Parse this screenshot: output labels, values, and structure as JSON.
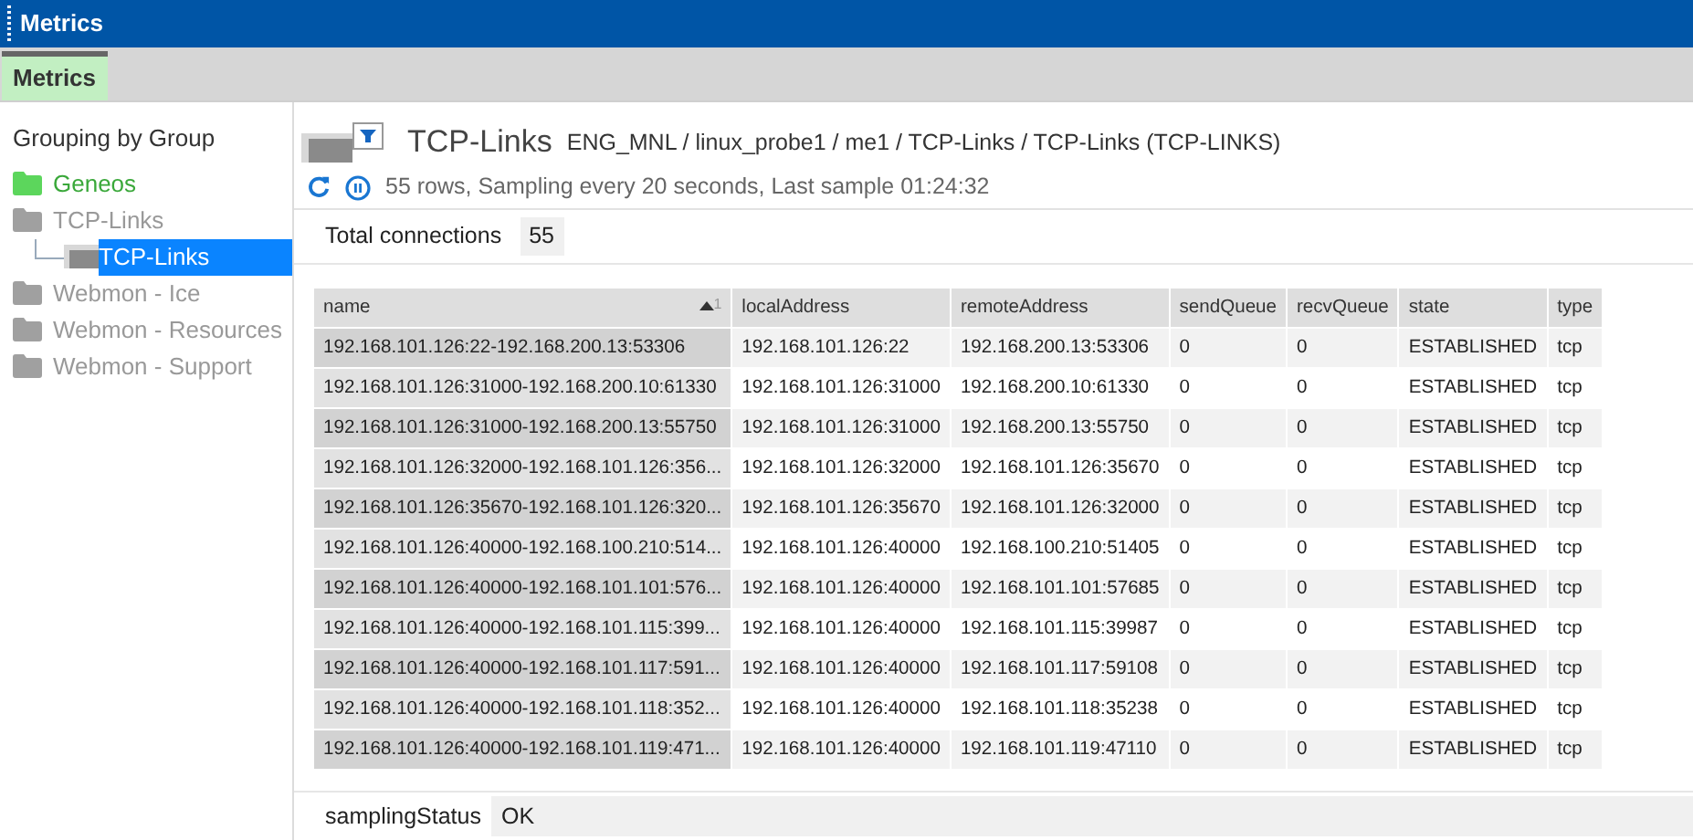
{
  "window": {
    "title": "Metrics"
  },
  "tabs": [
    {
      "label": "Metrics",
      "selected": true
    }
  ],
  "sidebar": {
    "title": "Grouping by Group",
    "items": [
      {
        "label": "Geneos",
        "color": "#5cd65c",
        "selected": false
      },
      {
        "label": "TCP-Links",
        "color": "#a0a0a0",
        "selected": false,
        "children": [
          {
            "label": "TCP-Links",
            "selected": true
          }
        ]
      },
      {
        "label": "Webmon - Ice",
        "color": "#a0a0a0",
        "selected": false
      },
      {
        "label": "Webmon - Resources",
        "color": "#a0a0a0",
        "selected": false
      },
      {
        "label": "Webmon - Support",
        "color": "#a0a0a0",
        "selected": false
      }
    ]
  },
  "view": {
    "title": "TCP-Links",
    "path": "ENG_MNL / linux_probe1 / me1 / TCP-Links / TCP-Links (TCP-LINKS)",
    "status": "55 rows, Sampling every 20 seconds, Last sample 01:24:32"
  },
  "headlines": [
    {
      "label": "Total connections",
      "value": "55"
    }
  ],
  "table": {
    "columns": [
      {
        "label": "name",
        "sort": "1"
      },
      {
        "label": "localAddress"
      },
      {
        "label": "remoteAddress"
      },
      {
        "label": "sendQueue"
      },
      {
        "label": "recvQueue"
      },
      {
        "label": "state"
      },
      {
        "label": "type"
      }
    ],
    "rows": [
      [
        "192.168.101.126:22-192.168.200.13:53306",
        "192.168.101.126:22",
        "192.168.200.13:53306",
        "0",
        "0",
        "ESTABLISHED",
        "tcp"
      ],
      [
        "192.168.101.126:31000-192.168.200.10:61330",
        "192.168.101.126:31000",
        "192.168.200.10:61330",
        "0",
        "0",
        "ESTABLISHED",
        "tcp"
      ],
      [
        "192.168.101.126:31000-192.168.200.13:55750",
        "192.168.101.126:31000",
        "192.168.200.13:55750",
        "0",
        "0",
        "ESTABLISHED",
        "tcp"
      ],
      [
        "192.168.101.126:32000-192.168.101.126:356...",
        "192.168.101.126:32000",
        "192.168.101.126:35670",
        "0",
        "0",
        "ESTABLISHED",
        "tcp"
      ],
      [
        "192.168.101.126:35670-192.168.101.126:320...",
        "192.168.101.126:35670",
        "192.168.101.126:32000",
        "0",
        "0",
        "ESTABLISHED",
        "tcp"
      ],
      [
        "192.168.101.126:40000-192.168.100.210:514...",
        "192.168.101.126:40000",
        "192.168.100.210:51405",
        "0",
        "0",
        "ESTABLISHED",
        "tcp"
      ],
      [
        "192.168.101.126:40000-192.168.101.101:576...",
        "192.168.101.126:40000",
        "192.168.101.101:57685",
        "0",
        "0",
        "ESTABLISHED",
        "tcp"
      ],
      [
        "192.168.101.126:40000-192.168.101.115:399...",
        "192.168.101.126:40000",
        "192.168.101.115:39987",
        "0",
        "0",
        "ESTABLISHED",
        "tcp"
      ],
      [
        "192.168.101.126:40000-192.168.101.117:591...",
        "192.168.101.126:40000",
        "192.168.101.117:59108",
        "0",
        "0",
        "ESTABLISHED",
        "tcp"
      ],
      [
        "192.168.101.126:40000-192.168.101.118:352...",
        "192.168.101.126:40000",
        "192.168.101.118:35238",
        "0",
        "0",
        "ESTABLISHED",
        "tcp"
      ],
      [
        "192.168.101.126:40000-192.168.101.119:471...",
        "192.168.101.126:40000",
        "192.168.101.119:47110",
        "0",
        "0",
        "ESTABLISHED",
        "tcp"
      ]
    ]
  },
  "footer": [
    {
      "label": "samplingStatus",
      "value": "OK"
    }
  ]
}
